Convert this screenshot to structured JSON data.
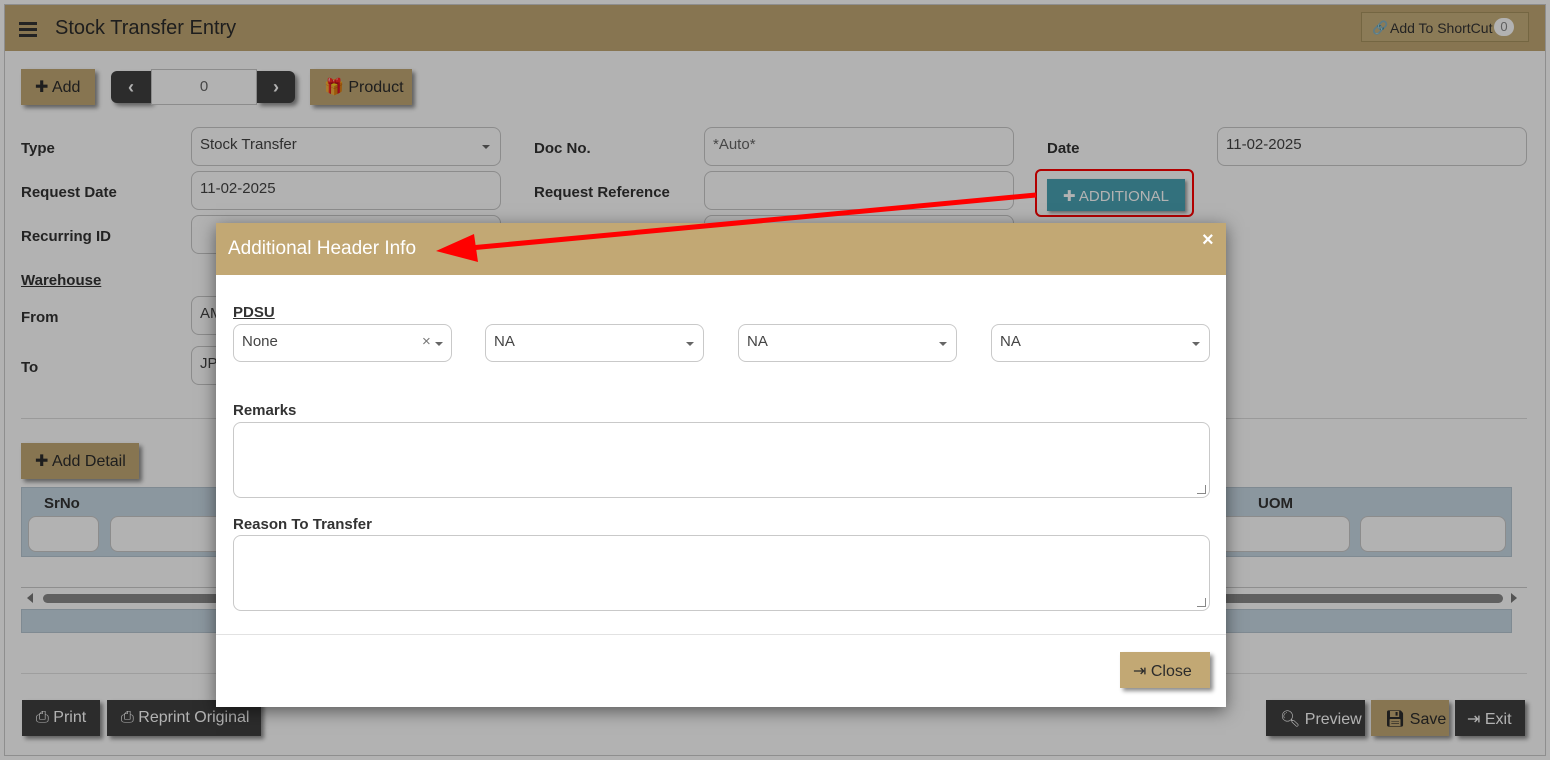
{
  "header": {
    "menu_icon": "hamburger-menu-icon",
    "title": "Stock Transfer Entry",
    "shortcut_label": "Add To ShortCut",
    "shortcut_count": "0"
  },
  "toolbar": {
    "add_label": "Add",
    "nav_value": "0",
    "product_label": "Product"
  },
  "form": {
    "type_label": "Type",
    "type_value": "Stock Transfer",
    "doc_label": "Doc No.",
    "doc_value": "*Auto*",
    "date_label": "Date",
    "date_value": "11-02-2025",
    "request_date_label": "Request Date",
    "request_date_value": "11-02-2025",
    "request_ref_label": "Request Reference",
    "additional_label": "ADDITIONAL",
    "recurring_label": "Recurring ID",
    "warehouse_label": "Warehouse",
    "from_label": "From",
    "from_value_partial": "AM",
    "to_label": "To",
    "to_value_partial": "JP"
  },
  "detail": {
    "add_detail_label": "Add Detail",
    "col_srno": "SrNo",
    "col_uom": "UOM"
  },
  "bottom": {
    "print_label": "Print",
    "reprint_label": "Reprint Original",
    "preview_label": "Preview",
    "save_label": "Save",
    "exit_label": "Exit"
  },
  "modal": {
    "title": "Additional Header Info",
    "close_x": "×",
    "pdsu_label": "PDSU",
    "selects": [
      "None",
      "NA",
      "NA",
      "NA"
    ],
    "clear_x": "×",
    "remarks_label": "Remarks",
    "reason_label": "Reason To Transfer",
    "close_label": "Close"
  },
  "colors": {
    "brand": "#c2a874",
    "dark_button": "#3f3f3f",
    "additional_button": "#4aa3b3",
    "annotation": "#ff0000"
  }
}
